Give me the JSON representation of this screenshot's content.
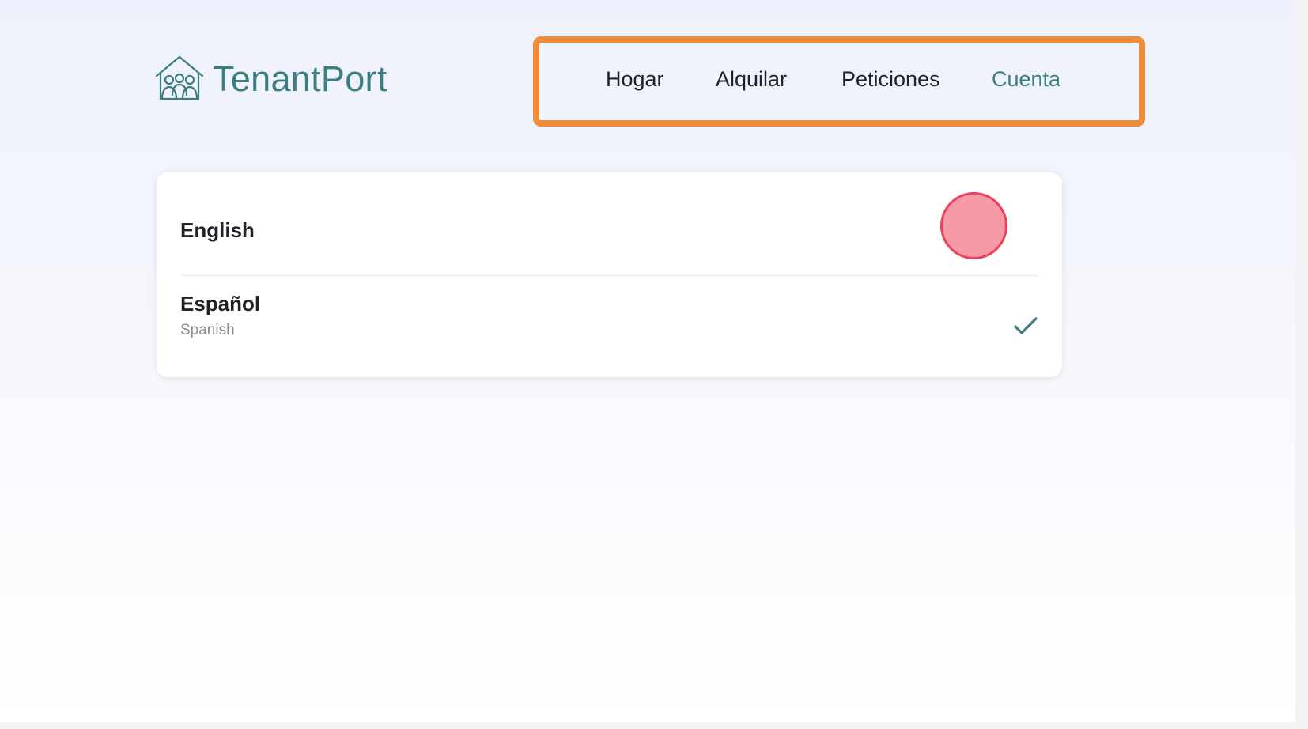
{
  "brand": {
    "name": "TenantPort",
    "icon": "house-people-icon",
    "color": "#3c7d80"
  },
  "nav": {
    "items": [
      {
        "label": "Hogar"
      },
      {
        "label": "Alquilar"
      },
      {
        "label": "Peticiones"
      },
      {
        "label": "Cuenta",
        "active": true
      }
    ],
    "highlight_color": "#ef8c3a"
  },
  "languages": {
    "options": [
      {
        "name": "English",
        "subtitle": "",
        "selected": false
      },
      {
        "name": "Español",
        "subtitle": "Spanish",
        "selected": true,
        "icon": "checkmark-icon"
      }
    ]
  },
  "click_indicator": {
    "fill": "#f69aa8",
    "stroke": "#ee3f5d"
  }
}
